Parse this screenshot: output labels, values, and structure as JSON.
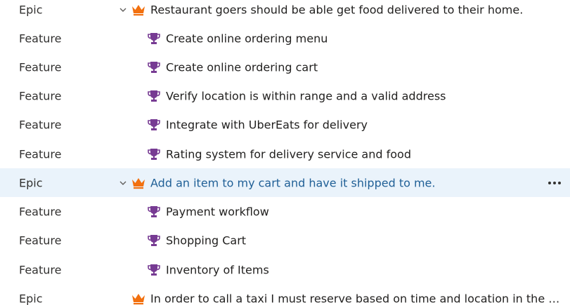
{
  "rows": [
    {
      "type": "Epic",
      "title": "Restaurant goers should be able get food delivered to their home.",
      "icon": "crown-icon",
      "expanded": true
    },
    {
      "type": "Feature",
      "title": "Create online ordering menu",
      "icon": "trophy-icon"
    },
    {
      "type": "Feature",
      "title": "Create online ordering cart",
      "icon": "trophy-icon"
    },
    {
      "type": "Feature",
      "title": "Verify location is within range and a valid address",
      "icon": "trophy-icon"
    },
    {
      "type": "Feature",
      "title": "Integrate with UberEats for delivery",
      "icon": "trophy-icon"
    },
    {
      "type": "Feature",
      "title": "Rating system for delivery service and food",
      "icon": "trophy-icon"
    },
    {
      "type": "Epic",
      "title": "Add an item to my cart and have it shipped to me.",
      "icon": "crown-icon",
      "expanded": true,
      "selected": true
    },
    {
      "type": "Feature",
      "title": "Payment workflow",
      "icon": "trophy-icon"
    },
    {
      "type": "Feature",
      "title": "Shopping Cart",
      "icon": "trophy-icon"
    },
    {
      "type": "Feature",
      "title": "Inventory of Items",
      "icon": "trophy-icon"
    },
    {
      "type": "Epic",
      "title": "In order to call a taxi I must reserve based on time and location in the mo...",
      "icon": "crown-icon",
      "expanded": false
    }
  ],
  "colors": {
    "epic_icon": "#f2700f",
    "feature_icon": "#773b93",
    "selected_row_bg": "#eaf3fb",
    "selected_title": "#1f5f96"
  },
  "more_actions_icon": "ellipsis-icon"
}
